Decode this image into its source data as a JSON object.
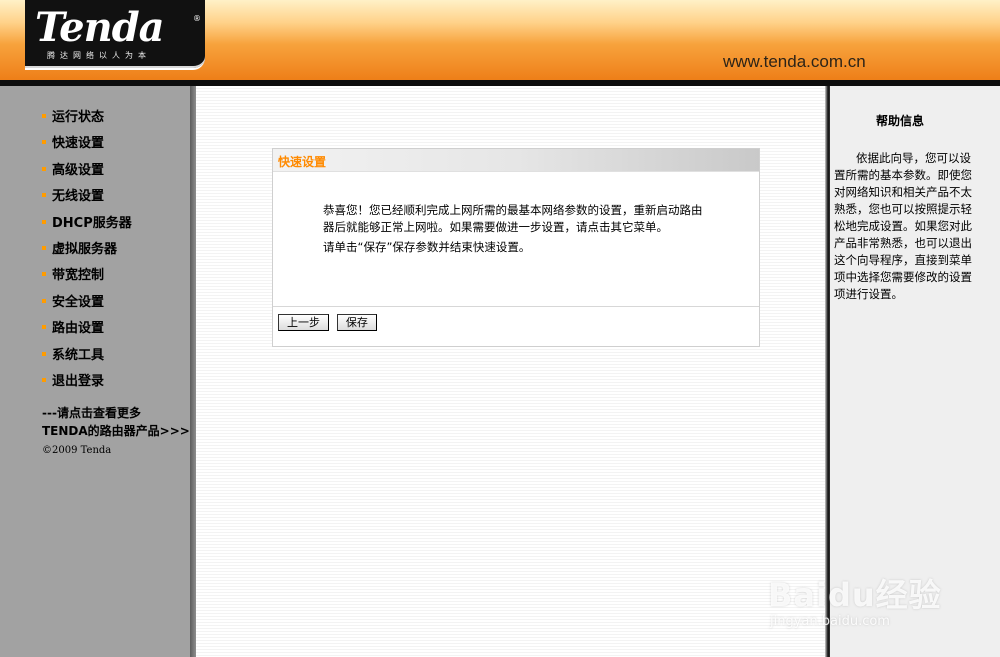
{
  "header": {
    "logo_text": "Tenda",
    "logo_reg": "®",
    "logo_slogan": "腾达网络以人为本",
    "site_url": "www.tenda.com.cn"
  },
  "sidebar": {
    "items": [
      {
        "label": "运行状态"
      },
      {
        "label": "快速设置"
      },
      {
        "label": "高级设置"
      },
      {
        "label": "无线设置"
      },
      {
        "label": "DHCP服务器"
      },
      {
        "label": "虚拟服务器"
      },
      {
        "label": "带宽控制"
      },
      {
        "label": "安全设置"
      },
      {
        "label": "路由设置"
      },
      {
        "label": "系统工具"
      },
      {
        "label": "退出登录"
      }
    ],
    "more_line1": "---请点击查看更多",
    "more_line2": "TENDA的路由器产品>>>",
    "copyright": "©2009 Tenda"
  },
  "panel": {
    "title": "快速设置",
    "message_1": "恭喜您！您已经顺利完成上网所需的最基本网络参数的设置，重新启动路由器后就能够正常上网啦。如果需要做进一步设置，请点击其它菜单。",
    "message_2": "请单击“保存”保存参数并结束快速设置。",
    "back_label": "上一步",
    "save_label": "保存"
  },
  "help": {
    "title": "帮助信息",
    "text": "依据此向导，您可以设置所需的基本参数。即使您对网络知识和相关产品不太熟悉，您也可以按照提示轻松地完成设置。如果您对此产品非常熟悉，也可以退出这个向导程序，直接到菜单项中选择您需要修改的设置项进行设置。"
  },
  "watermark": {
    "main": "Baidu经验",
    "sub": "jingyan.baidu.com"
  },
  "colors": {
    "accent_orange": "#ff8a00",
    "sidebar_bg": "#a2a2a2",
    "header_orange": "#ee7f18"
  }
}
